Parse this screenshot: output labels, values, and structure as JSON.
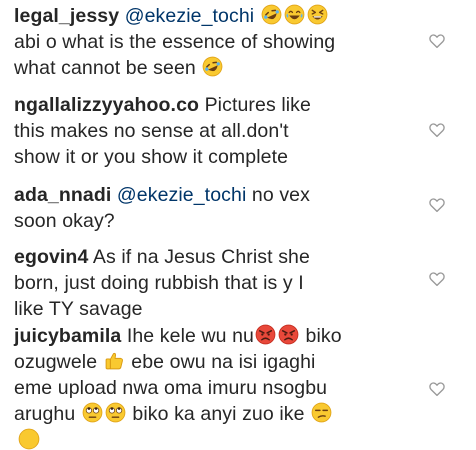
{
  "comments": [
    {
      "username": "legal_jessy",
      "mention": "@ekezie_tochi",
      "line1_text": "abi o what is the essence of showing",
      "line2_text": "what cannot be seen",
      "emojis": [
        "rofl-emoji",
        "tears-of-joy-emoji",
        "grinning-squinting-emoji",
        "rofl-emoji"
      ],
      "liked": false
    },
    {
      "username": "ngallalizzyyahoo.co",
      "line1_text": "Pictures like",
      "line2_text": "this makes no sense at all.don't",
      "line3_text": "show it or you show it complete",
      "liked": false
    },
    {
      "username": "ada_nnadi",
      "mention": "@ekezie_tochi",
      "line1_text": "no vex",
      "line2_text": "soon okay?",
      "liked": false
    },
    {
      "username": "egovin4",
      "line1_text": "As if na Jesus Christ she",
      "line2_text": "born, just doing rubbish that is y I",
      "line3_text": "like TY savage",
      "liked": false
    },
    {
      "username": "juicybamila",
      "line1_text": "Ihe kele wu nu",
      "line2_a": "ozugwele",
      "line2_b": "ebe owu na isi igaghi",
      "line3_text": "eme upload nwa oma imuru nsogbu",
      "line4_a": "arughu",
      "line4_b": "biko ka anyi zuo ike",
      "line1_tail": "biko",
      "emojis": [
        "pouting-face-emoji",
        "pouting-face-emoji",
        "thumbs-up-emoji",
        "rolling-eyes-emoji",
        "rolling-eyes-emoji",
        "unamused-face-emoji"
      ],
      "liked": false
    }
  ],
  "colors": {
    "text": "#262626",
    "mention": "#003569",
    "heart_outline": "#999999"
  }
}
